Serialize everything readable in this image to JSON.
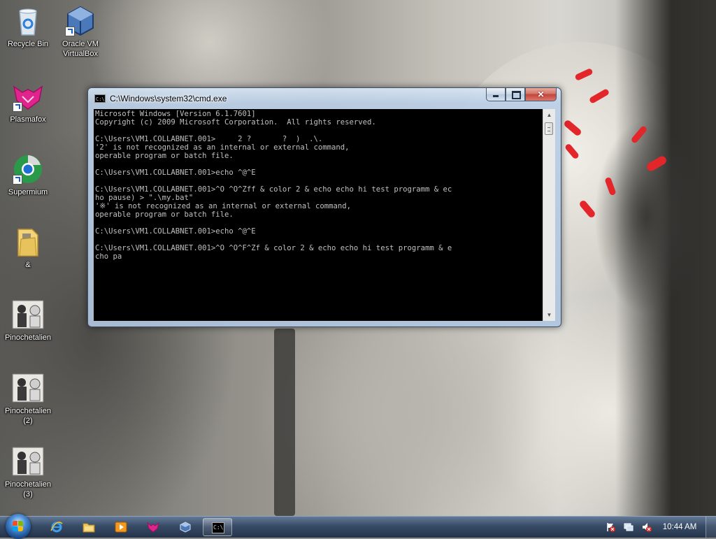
{
  "desktop": {
    "icons": [
      {
        "label": "Recycle Bin",
        "icon": "recycle-bin-icon"
      },
      {
        "label": "Oracle VM VirtualBox",
        "icon": "virtualbox-icon"
      },
      {
        "label": "Plasmafox",
        "icon": "plasmafox-icon"
      },
      {
        "label": "Supermium",
        "icon": "supermium-icon"
      },
      {
        "label": "&",
        "icon": "folder-icon"
      },
      {
        "label": "Pinochetalien",
        "icon": "image-file-icon"
      },
      {
        "label": "Pinochetalien (2)",
        "icon": "image-file-icon"
      },
      {
        "label": "Pinochetalien (3)",
        "icon": "image-file-icon"
      }
    ]
  },
  "cmd_window": {
    "title": "C:\\Windows\\system32\\cmd.exe",
    "icon_text": "C:\\",
    "close_symbol": "✕",
    "console_text": "Microsoft Windows [Version 6.1.7601]\nCopyright (c) 2009 Microsoft Corporation.  All rights reserved.\n\nC:\\Users\\VM1.COLLABNET.001>     2 ?       ?  )  .\\.\n'2' is not recognized as an internal or external command,\noperable program or batch file.\n\nC:\\Users\\VM1.COLLABNET.001>echo ^@^E\n\nC:\\Users\\VM1.COLLABNET.001>^O ^O^Zff & color 2 & echo echo hi test programm & ec\nho pause) > \".\\my.bat\"\n'※' is not recognized as an internal or external command,\noperable program or batch file.\n\nC:\\Users\\VM1.COLLABNET.001>echo ^@^E\n\nC:\\Users\\VM1.COLLABNET.001>^O ^O^F^Zf & color 2 & echo echo hi test programm & e\ncho pa",
    "scroll_up": "▲",
    "scroll_down": "▼"
  },
  "taskbar": {
    "pinned": [
      {
        "icon": "internet-explorer-icon"
      },
      {
        "icon": "file-explorer-icon"
      },
      {
        "icon": "media-player-icon"
      },
      {
        "icon": "plasmafox-icon"
      },
      {
        "icon": "virtualbox-icon"
      },
      {
        "icon": "cmd-icon",
        "active": true
      }
    ],
    "cmd_icon_text": "C:\\",
    "clock": "10:44 AM"
  },
  "colors": {
    "console_bg": "#000000",
    "console_fg": "#c0c0c0",
    "close_button": "#c4443a"
  }
}
